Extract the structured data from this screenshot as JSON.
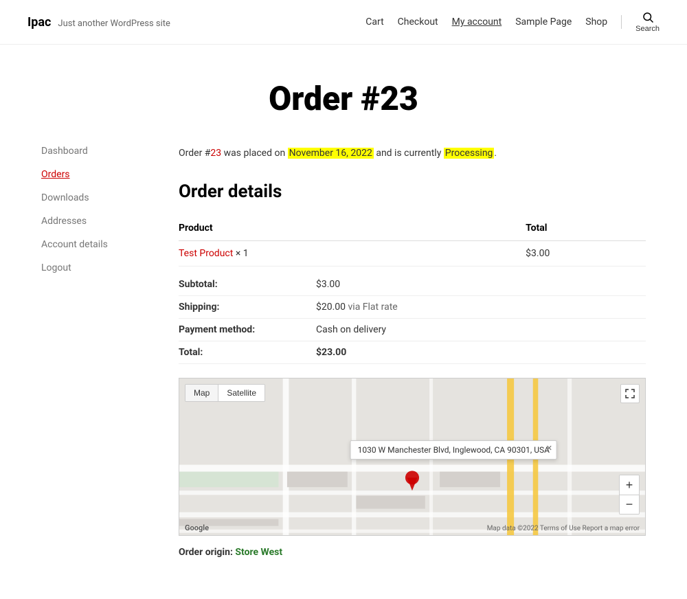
{
  "site": {
    "name": "Ipac",
    "tagline": "Just another WordPress site"
  },
  "nav": {
    "links": [
      {
        "label": "Cart",
        "id": "cart"
      },
      {
        "label": "Checkout",
        "id": "checkout"
      },
      {
        "label": "My account",
        "id": "my-account"
      },
      {
        "label": "Sample Page",
        "id": "sample-page"
      },
      {
        "label": "Shop",
        "id": "shop"
      }
    ],
    "search_label": "Search"
  },
  "page": {
    "title": "Order #23"
  },
  "sidebar": {
    "items": [
      {
        "label": "Dashboard",
        "id": "dashboard",
        "active": false
      },
      {
        "label": "Orders",
        "id": "orders",
        "active": true
      },
      {
        "label": "Downloads",
        "id": "downloads",
        "active": false
      },
      {
        "label": "Addresses",
        "id": "addresses",
        "active": false
      },
      {
        "label": "Account details",
        "id": "account-details",
        "active": false
      },
      {
        "label": "Logout",
        "id": "logout",
        "active": false
      }
    ]
  },
  "order": {
    "status_msg_prefix": "Order #",
    "order_number": "23",
    "status_msg_mid": " was placed on ",
    "order_date": "November 16, 2022",
    "status_msg_mid2": " and is currently ",
    "order_status": "Processing",
    "status_msg_suffix": ".",
    "details_title": "Order details",
    "table": {
      "col_product": "Product",
      "col_total": "Total",
      "product_name": "Test Product",
      "product_qty": "× 1",
      "product_total": "$3.00"
    },
    "summary": [
      {
        "label": "Subtotal:",
        "value": "$3.00",
        "note": ""
      },
      {
        "label": "Shipping:",
        "value": "$20.00",
        "note": " via Flat rate"
      },
      {
        "label": "Payment method:",
        "value": "Cash on delivery",
        "note": ""
      },
      {
        "label": "Total:",
        "value": "$23.00",
        "note": ""
      }
    ],
    "map": {
      "tab_map": "Map",
      "tab_satellite": "Satellite",
      "address_tooltip": "1030 W Manchester Blvd, Inglewood, CA 90301, USA",
      "branding": "Google",
      "attribution": "Map data ©2022  Terms of Use  Report a map error"
    },
    "origin_label": "Order origin:",
    "origin_store": "Store West"
  }
}
